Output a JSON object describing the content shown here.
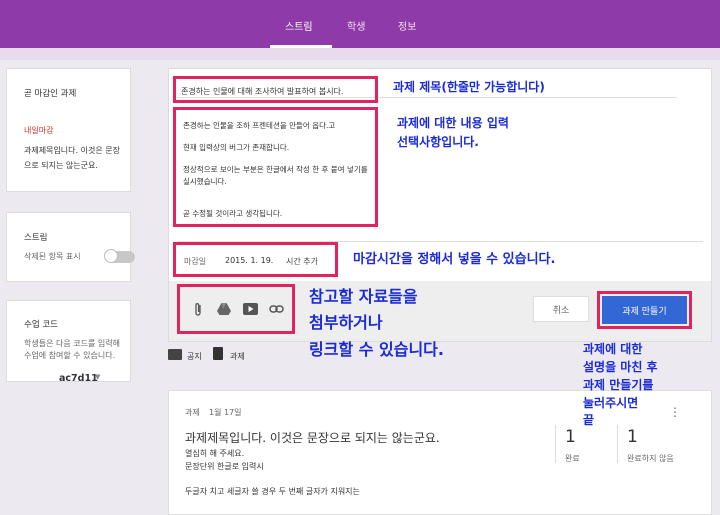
{
  "nav": {
    "tabs": [
      "스트림",
      "학생",
      "정보"
    ]
  },
  "sidebar": {
    "upcoming": {
      "title": "곧 마감인 과제",
      "empty": "내일마감",
      "desc": "과제제목입니다. 이것은 문장으로 되지는 않는군요."
    },
    "stream": {
      "title": "스트림",
      "toggle_label": "삭제된 항목 표시"
    },
    "classcode": {
      "title": "수업 코드",
      "desc": "학생들은 다음 코드를 입력해 수업에 참여할 수 있습니다.",
      "code": "ac7d11"
    }
  },
  "compose": {
    "title_value": "존경하는 인물에 대해 조사하여 발표하여 봅시다.",
    "desc_lines": [
      "존경하는 인물을 조하 프젠테션을 만들어 옵다.고",
      "현재 입력상의 버그가 존재합니다.",
      "정상적으로 보이는 부분은 한글에서 작성 한 후 붙여 넣기를 실시했습니다.",
      "곧 수정될 것이라고 생각됩니다."
    ],
    "due_label": "마감일",
    "due_date": "2015. 1. 19.",
    "add_time": "시간 추가",
    "cancel": "취소",
    "create": "과제 만들기"
  },
  "post_tabs": {
    "notice": "공지",
    "assignment": "과제"
  },
  "assignment_card": {
    "kind": "과제",
    "date": "1월 17일",
    "title": "과제제목입니다. 이것은 문장으로 되지는 않는군요.",
    "line1": "열심히 해 주세요.",
    "line2": "문장단위 한글로 입력시",
    "line3": "두글자 치고 세글자 쓸 경우 두 번째 글자가 지워지는",
    "done_count": "1",
    "done_label": "완료",
    "notdone_count": "1",
    "notdone_label": "완료하지 않음"
  },
  "annotations": {
    "title_hint": "과제 제목(한줄만 가능합니다)",
    "desc_hint_1": "과제에 대한 내용 입력",
    "desc_hint_2": "선택사항입니다.",
    "due_hint": "마감시간을 정해서 넣을 수 있습니다.",
    "attach_hint_1": "참고할 자료들을",
    "attach_hint_2": "첨부하거나",
    "attach_hint_3": "링크할 수 있습니다.",
    "create_hint_1": "과제에 대한",
    "create_hint_2": "설명을 마친 후",
    "create_hint_3": "과제 만들기를",
    "create_hint_4": "눌러주시면",
    "create_hint_5": "끝"
  },
  "colors": {
    "topbar": "#8e3aa8",
    "annotation_text": "#1a2bd6",
    "annotation_box": "#e0245e",
    "primary": "#3367d6"
  }
}
